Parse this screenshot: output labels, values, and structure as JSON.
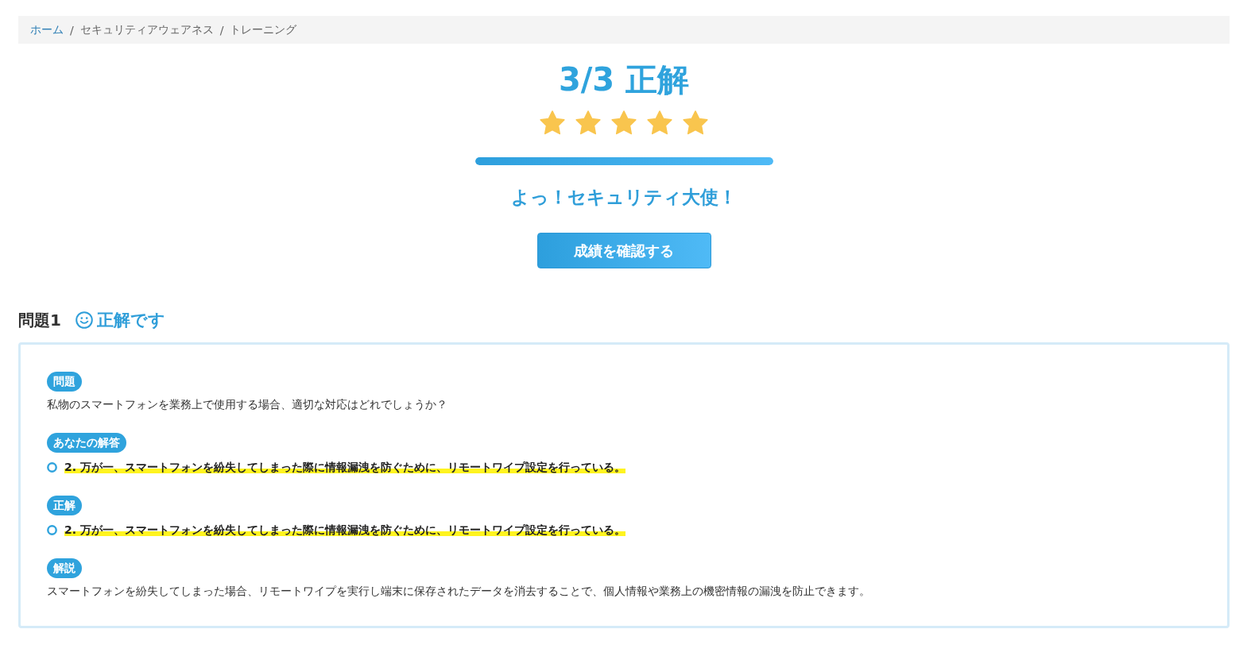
{
  "breadcrumb": [
    {
      "kind": "link",
      "label": "ホーム"
    },
    {
      "kind": "separator",
      "label": "/"
    },
    {
      "kind": "text",
      "label": "セキュリティアウェアネス"
    },
    {
      "kind": "separator",
      "label": "/"
    },
    {
      "kind": "text",
      "label": "トレーニング"
    }
  ],
  "result": {
    "score": "3/3 正解",
    "stars": 5,
    "progress": {
      "level": 1
    },
    "message": "よっ！セキュリティ大使！",
    "button": "成績を確認する"
  },
  "questions": [
    {
      "title": "問題1",
      "correct": true,
      "verdict": "正解です",
      "sections": [
        {
          "kind": "text",
          "badge": "問題",
          "text": "私物のスマートフォンを業務上で使用する場合、適切な対応はどれでしょうか？"
        },
        {
          "kind": "answer",
          "badge": "あなたの解答",
          "text": "2. 万が一、スマートフォンを紛失してしまった際に情報漏洩を防ぐために、リモートワイプ設定を行っている。",
          "highlighted": true
        },
        {
          "kind": "answer",
          "badge": "正解",
          "text": "2. 万が一、スマートフォンを紛失してしまった際に情報漏洩を防ぐために、リモートワイプ設定を行っている。",
          "highlighted": true
        },
        {
          "kind": "text",
          "badge": "解説",
          "text": "スマートフォンを紛失してしまった場合、リモートワイプを実行し端末に保存されたデータを消去することで、個人情報や業務上の機密情報の漏洩を防止できます。"
        }
      ]
    }
  ]
}
